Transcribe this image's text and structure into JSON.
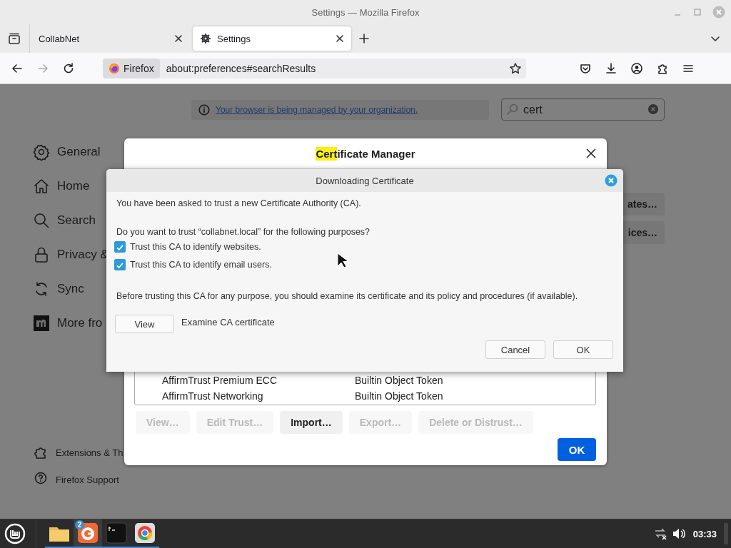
{
  "window": {
    "title": "Settings — Mozilla Firefox"
  },
  "tabs": [
    {
      "label": "CollabNet",
      "selected": false
    },
    {
      "label": "Settings",
      "selected": true
    }
  ],
  "nav_buttons": [
    {
      "kind": "back",
      "disabled": false
    },
    {
      "kind": "forward",
      "disabled": true
    },
    {
      "kind": "reload",
      "disabled": false
    }
  ],
  "address_bar": {
    "identity": "Firefox",
    "url": "about:preferences#searchResults"
  },
  "settings": {
    "notice": "Your browser is being managed by your organization.",
    "search": {
      "value": "cert"
    },
    "sidebar": {
      "items": [
        {
          "kind": "general",
          "label": "General"
        },
        {
          "kind": "home",
          "label": "Home"
        },
        {
          "kind": "search",
          "label": "Search"
        },
        {
          "kind": "privacy",
          "label": "Privacy &"
        },
        {
          "kind": "sync",
          "label": "Sync"
        },
        {
          "kind": "more",
          "label": "More fro"
        }
      ],
      "footer": [
        {
          "kind": "extensions",
          "label": "Extensions & Th"
        },
        {
          "kind": "support",
          "label": "Firefox Support"
        }
      ]
    },
    "buttons": [
      "ates…",
      "ices…"
    ]
  },
  "certificate_manager": {
    "title_parts": [
      {
        "text": "Cert",
        "highlighted": true
      },
      {
        "text": "ificate Manager",
        "highlighted": false
      }
    ],
    "rows": [
      {
        "name": "AffirmTrust Premium ECC",
        "device": "Builtin Object Token"
      },
      {
        "name": "AffirmTrust Networking",
        "device": "Builtin Object Token"
      }
    ],
    "buttons": [
      {
        "label": "View…",
        "disabled": true
      },
      {
        "label": "Edit Trust…",
        "disabled": true
      },
      {
        "label": "Import…",
        "disabled": false
      },
      {
        "label": "Export…",
        "disabled": true
      },
      {
        "label": "Delete or Distrust…",
        "disabled": true
      }
    ],
    "ok": "OK"
  },
  "download_dialog": {
    "title": "Downloading Certificate",
    "intro": "You have been asked to trust a new Certificate Authority (CA).",
    "question": "Do you want to trust “collabnet.local” for the following purposes?",
    "options": [
      {
        "label": "Trust this CA to identify websites.",
        "checked": true
      },
      {
        "label": "Trust this CA to identify email users.",
        "checked": true
      }
    ],
    "advice": "Before trusting this CA for any purpose, you should examine its certificate and its policy and procedures (if available).",
    "view_button": "View",
    "view_caption": "Examine CA certificate",
    "buttons": [
      "Cancel",
      "OK"
    ]
  },
  "taskbar": {
    "apps": [
      {
        "kind": "folder"
      },
      {
        "kind": "firefox",
        "badge": "2"
      },
      {
        "kind": "terminal"
      },
      {
        "kind": "chrome"
      }
    ],
    "clock": "03:33"
  }
}
